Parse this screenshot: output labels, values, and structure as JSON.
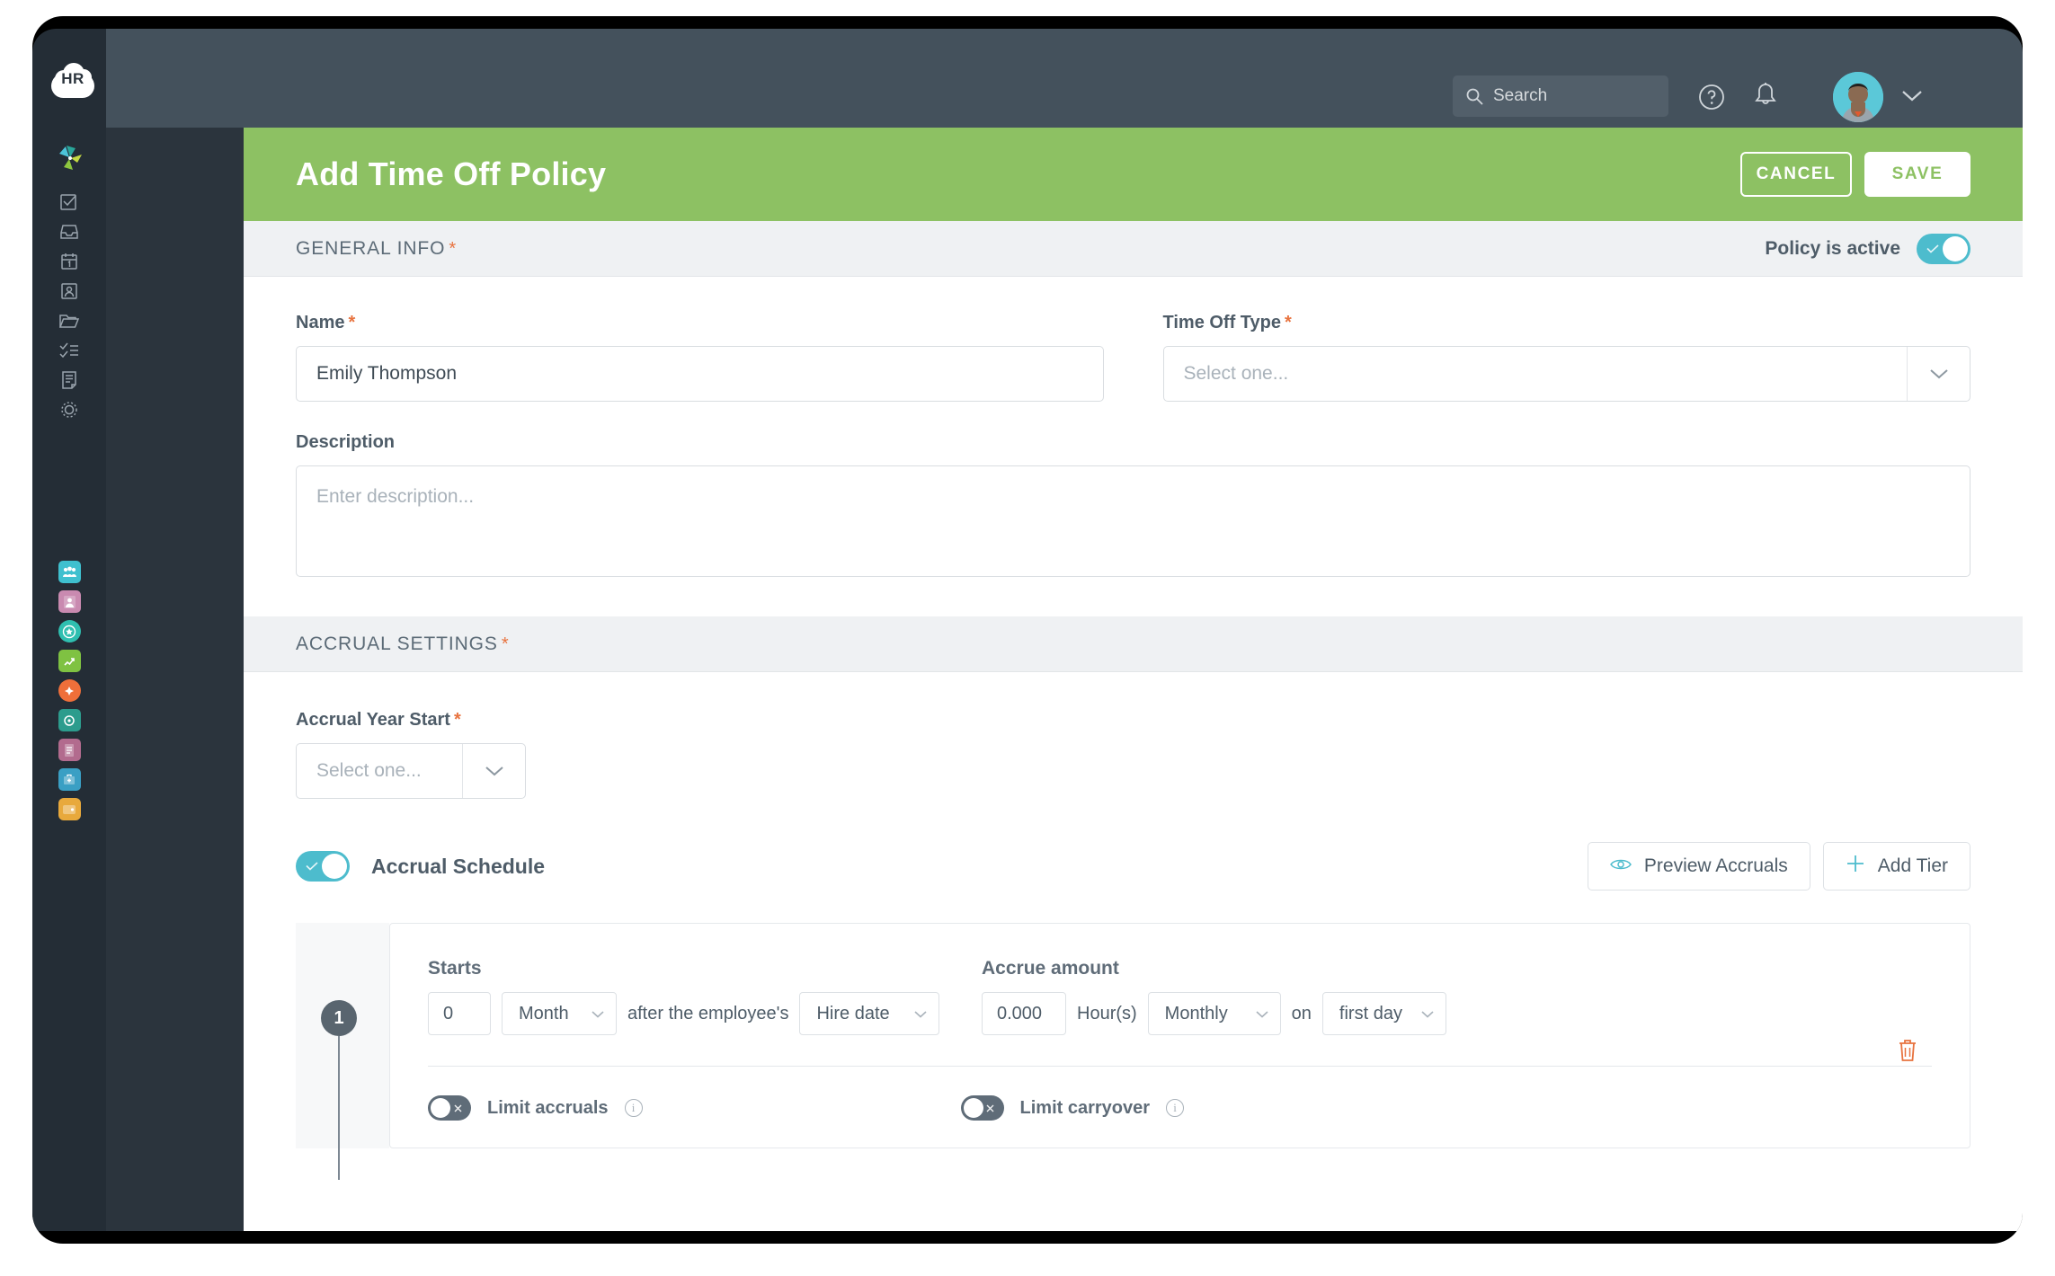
{
  "app": {
    "logo_text": "HR",
    "brand_icon": "pinwheel-logo"
  },
  "sidebar": {
    "nav_items": [
      {
        "name": "tasks",
        "icon": "checkbox-check-icon"
      },
      {
        "name": "inbox",
        "icon": "inbox-tray-icon"
      },
      {
        "name": "calendar",
        "icon": "calendar-icon"
      },
      {
        "name": "employee",
        "icon": "id-badge-icon"
      },
      {
        "name": "files",
        "icon": "folder-icon"
      },
      {
        "name": "checklist",
        "icon": "checklist-icon"
      },
      {
        "name": "reports",
        "icon": "document-icon"
      },
      {
        "name": "settings",
        "icon": "gear-icon"
      }
    ],
    "app_items": [
      {
        "name": "people-app",
        "icon": "people-card-icon",
        "color": "#3fc0cf"
      },
      {
        "name": "directory-app",
        "icon": "contact-card-icon",
        "color": "#c98ab0"
      },
      {
        "name": "recognition-app",
        "icon": "award-badge-icon",
        "color": "#2fbfb0"
      },
      {
        "name": "performance-app",
        "icon": "leaf-chart-icon",
        "color": "#7fc242"
      },
      {
        "name": "compass-app",
        "icon": "compass-icon",
        "color": "#ef6f3a"
      },
      {
        "name": "insights-app",
        "icon": "screen-target-icon",
        "color": "#2c9c8d"
      },
      {
        "name": "payroll-app",
        "icon": "payroll-icon",
        "color": "#b26b8e"
      },
      {
        "name": "benefits-app",
        "icon": "benefits-icon",
        "color": "#3a9fc4"
      },
      {
        "name": "wallet-app",
        "icon": "wallet-icon",
        "color": "#e8a93c"
      }
    ]
  },
  "topbar": {
    "search": {
      "placeholder": "Search",
      "value": "",
      "icon": "search-icon"
    },
    "help_icon": "question-circle-icon",
    "notifications_icon": "bell-icon",
    "avatar": "user-avatar",
    "account_chevron": "chevron-down-icon"
  },
  "header": {
    "title": "Add Time Off Policy",
    "cancel_label": "CANCEL",
    "save_label": "SAVE",
    "accent_color": "#8dc163"
  },
  "general_info": {
    "section_title": "GENERAL INFO",
    "required_mark": "*",
    "policy_active_label": "Policy is active",
    "policy_active_state": "on",
    "name": {
      "label": "Name",
      "required_mark": "*",
      "value": "Emily Thompson",
      "placeholder": ""
    },
    "time_off_type": {
      "label": "Time Off Type",
      "required_mark": "*",
      "value": "",
      "placeholder": "Select one...",
      "caret": "chevron-down-icon"
    },
    "description": {
      "label": "Description",
      "value": "",
      "placeholder": "Enter description..."
    }
  },
  "accrual_settings": {
    "section_title": "ACCRUAL SETTINGS",
    "required_mark": "*",
    "accrual_year_start": {
      "label": "Accrual Year Start",
      "required_mark": "*",
      "value": "",
      "placeholder": "Select one...",
      "caret": "chevron-down-icon"
    },
    "accrual_schedule": {
      "label": "Accrual Schedule",
      "state": "on"
    },
    "preview_accruals_label": "Preview Accruals",
    "preview_icon": "eye-icon",
    "add_tier_label": "Add Tier",
    "add_tier_icon": "plus-icon",
    "tier": {
      "number": "1",
      "starts": {
        "label": "Starts",
        "amount_value": "0",
        "unit_value": "Month",
        "connector_text": "after the employee's",
        "anchor_value": "Hire date"
      },
      "accrue": {
        "label": "Accrue amount",
        "amount_value": "0.000",
        "unit_text": "Hour(s)",
        "frequency_value": "Monthly",
        "on_text": "on",
        "day_value": "first day"
      },
      "limit_accruals": {
        "label": "Limit accruals",
        "state": "off",
        "info_icon": "info-icon"
      },
      "limit_carryover": {
        "label": "Limit carryover",
        "state": "off",
        "info_icon": "info-icon"
      },
      "delete_icon": "trash-icon"
    }
  }
}
